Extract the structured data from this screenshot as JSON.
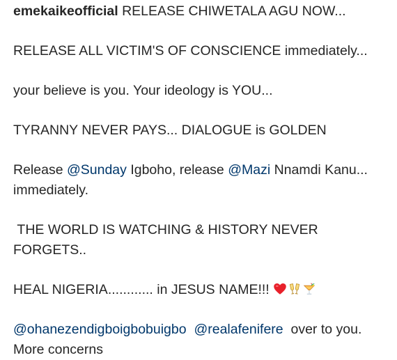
{
  "post": {
    "username": "emekaikeofficial",
    "line1": " RELEASE CHIWETALA AGU NOW...",
    "line2": "RELEASE ALL VICTIM'S OF CONSCIENCE immediately...",
    "line3": "your believe is you. Your ideology is YOU...",
    "line4": "TYRANNY NEVER PAYS... DIALOGUE is GOLDEN",
    "line5_a": "Release ",
    "line5_mention1": "@Sunday",
    "line5_b": " Igboho, release ",
    "line5_mention2": "@Mazi",
    "line5_c": " Nnamdi Kanu... immediately.",
    "line6": " THE WORLD IS WATCHING & HISTORY NEVER FORGETS..",
    "line7": "HEAL NIGERIA............ in JESUS NAME!!! ",
    "line8_mention1": "@ohanezendigboigbobuigbo",
    "line8_gap": "  ",
    "line8_mention2": "@realafenifere",
    "line8_b": "  over to you. More concerns"
  },
  "emojis": [
    "red-heart-icon",
    "clinking-glasses-icon",
    "tropical-drink-icon"
  ],
  "colors": {
    "text": "#262626",
    "mention": "#00376b",
    "heart": "#e8202a"
  }
}
